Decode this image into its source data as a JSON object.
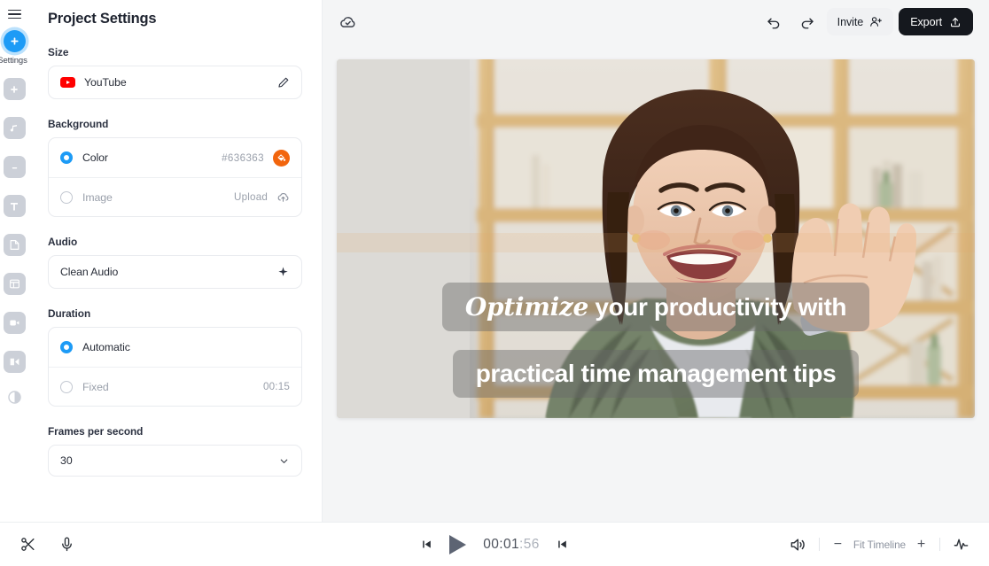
{
  "rail": {
    "menu_icon": "hamburger-menu-icon",
    "active_item": {
      "label": "Settings",
      "icon": "plus-circle-icon"
    },
    "items": [
      {
        "icon": "add-media-icon"
      },
      {
        "icon": "music-note-icon"
      },
      {
        "icon": "subtitles-icon"
      },
      {
        "icon": "text-icon"
      },
      {
        "icon": "sticker-icon"
      },
      {
        "icon": "template-layout-icon"
      },
      {
        "icon": "video-camera-icon"
      },
      {
        "icon": "transition-icon"
      },
      {
        "icon": "filter-contrast-icon"
      }
    ]
  },
  "panel": {
    "title": "Project Settings",
    "size": {
      "label": "Size",
      "preset": "YouTube",
      "preset_icon": "youtube-icon",
      "edit_icon": "pencil-icon"
    },
    "background": {
      "label": "Background",
      "color_option": {
        "label": "Color",
        "value": "#636363",
        "selected": true,
        "swatch_color": "#f2650d",
        "swatch_icon": "paint-bucket-icon"
      },
      "image_option": {
        "label": "Image",
        "action": "Upload",
        "selected": false,
        "icon": "upload-cloud-icon"
      }
    },
    "audio": {
      "label": "Audio",
      "option": "Clean Audio",
      "icon": "sparkle-icon"
    },
    "duration": {
      "label": "Duration",
      "automatic": {
        "label": "Automatic",
        "selected": true
      },
      "fixed": {
        "label": "Fixed",
        "value": "00:15",
        "selected": false
      }
    },
    "fps": {
      "label": "Frames per second",
      "value": "30",
      "icon": "chevron-down-icon"
    }
  },
  "stage": {
    "save_status_icon": "cloud-check-icon",
    "undo_icon": "undo-arrow-icon",
    "redo_icon": "redo-arrow-icon",
    "invite_label": "Invite",
    "invite_icon": "add-person-icon",
    "export_label": "Export",
    "export_icon": "upload-box-icon",
    "caption_line1_italic": "Optimize",
    "caption_line1_rest": " your productivity with",
    "caption_line2": "practical time management tips"
  },
  "bottom": {
    "split_icon": "scissors-icon",
    "mic_icon": "microphone-icon",
    "skip_back_icon": "skip-to-start-icon",
    "play_icon": "play-icon",
    "skip_forward_icon": "skip-to-end-icon",
    "time_main": "00:01",
    "time_frames": ":56",
    "volume_icon": "volume-icon",
    "zoom_out_label": "−",
    "zoom_label": "Fit Timeline",
    "zoom_in_label": "+",
    "waveform_icon": "waveform-icon"
  },
  "colors": {
    "accent_blue": "#1d9bf6",
    "swatch_orange": "#f2650d",
    "export_dark": "#15181e",
    "bg_grey": "#f4f5f6"
  }
}
